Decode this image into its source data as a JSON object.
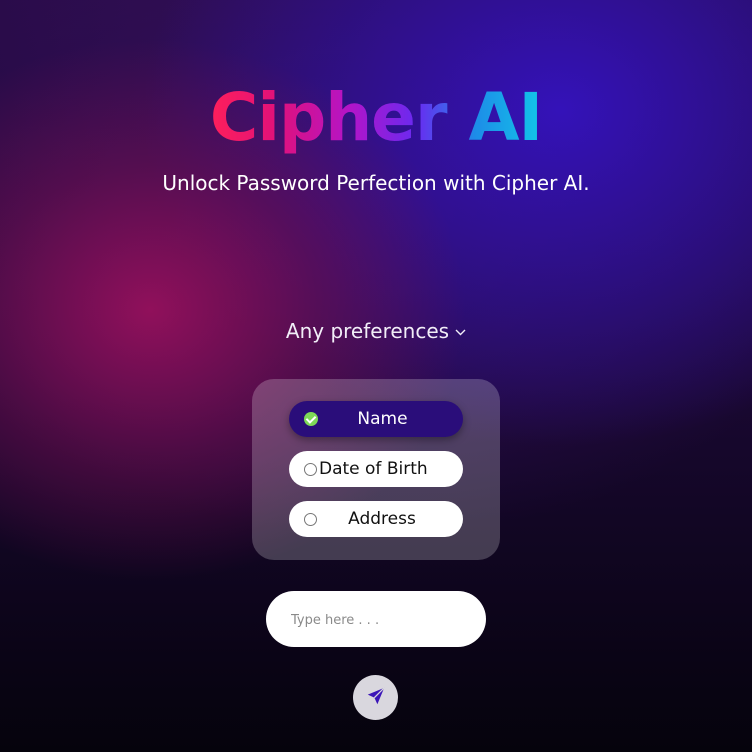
{
  "app": {
    "title": "Cipher AI",
    "subtitle": "Unlock Password Perfection with Cipher AI."
  },
  "preferences": {
    "toggle_label": "Any preferences",
    "toggle_icon": "chevron-down-icon",
    "options": [
      {
        "label": "Name",
        "selected": true
      },
      {
        "label": "Date of Birth",
        "selected": false
      },
      {
        "label": "Address",
        "selected": false
      }
    ]
  },
  "input": {
    "value": "",
    "placeholder": "Type here . . ."
  },
  "send": {
    "icon": "send-icon"
  },
  "colors": {
    "title_gradient": [
      "#ff1f5a",
      "#b314c8",
      "#6a2af0",
      "#12c6e8"
    ],
    "selected_option_bg": "#2a0d7a",
    "checkmark": "#7ed957",
    "send_icon": "#3a14b8"
  }
}
